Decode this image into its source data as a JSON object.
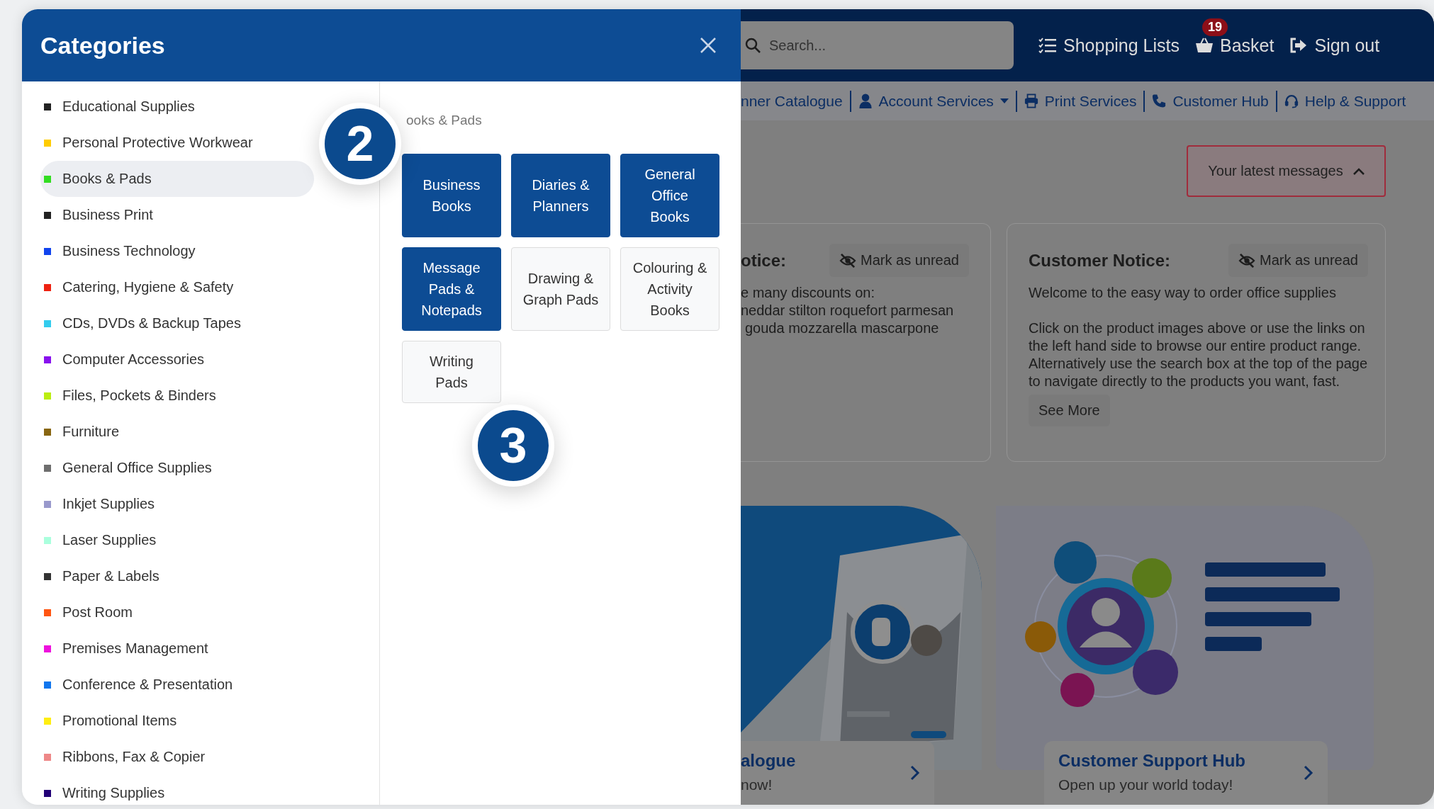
{
  "drawer": {
    "title": "Categories",
    "categories": [
      {
        "label": "Educational Supplies",
        "color": "#222222",
        "selected": false
      },
      {
        "label": "Personal Protective Workwear",
        "color": "#ffcc00",
        "selected": false
      },
      {
        "label": "Books & Pads",
        "color": "#33dd22",
        "selected": true
      },
      {
        "label": "Business Print",
        "color": "#222222",
        "selected": false
      },
      {
        "label": "Business Technology",
        "color": "#1144ee",
        "selected": false
      },
      {
        "label": "Catering, Hygiene & Safety",
        "color": "#ee2211",
        "selected": false
      },
      {
        "label": "CDs, DVDs & Backup Tapes",
        "color": "#33ccee",
        "selected": false
      },
      {
        "label": "Computer Accessories",
        "color": "#8811ee",
        "selected": false
      },
      {
        "label": "Files, Pockets & Binders",
        "color": "#bbee11",
        "selected": false
      },
      {
        "label": "Furniture",
        "color": "#886611",
        "selected": false
      },
      {
        "label": "General Office Supplies",
        "color": "#6e6e6e",
        "selected": false
      },
      {
        "label": "Inkjet Supplies",
        "color": "#9999cc",
        "selected": false
      },
      {
        "label": "Laser Supplies",
        "color": "#aaffdd",
        "selected": false
      },
      {
        "label": "Paper & Labels",
        "color": "#333333",
        "selected": false
      },
      {
        "label": "Post Room",
        "color": "#ff5511",
        "selected": false
      },
      {
        "label": "Premises Management",
        "color": "#ee11dd",
        "selected": false
      },
      {
        "label": "Conference & Presentation",
        "color": "#1177ee",
        "selected": false
      },
      {
        "label": "Promotional Items",
        "color": "#ffee11",
        "selected": false
      },
      {
        "label": "Ribbons, Fax & Copier",
        "color": "#ee8888",
        "selected": false
      },
      {
        "label": "Writing Supplies",
        "color": "#220077",
        "selected": false
      }
    ],
    "subcategory_heading": "ooks & Pads",
    "subcategories": [
      {
        "label": "Business Books",
        "highlighted": true
      },
      {
        "label": "Diaries & Planners",
        "highlighted": true
      },
      {
        "label": "General Office Books",
        "highlighted": true
      },
      {
        "label": "Message Pads & Notepads",
        "highlighted": true
      },
      {
        "label": "Drawing & Graph Pads",
        "highlighted": false
      },
      {
        "label": "Colouring & Activity Books",
        "highlighted": false
      },
      {
        "label": "Writing Pads",
        "highlighted": false
      }
    ],
    "step_markers": [
      "2",
      "3"
    ]
  },
  "page": {
    "search": {
      "placeholder": "Search..."
    },
    "header_links": [
      {
        "label": "Shopping Lists",
        "kind": "lists"
      },
      {
        "label": "Basket",
        "kind": "basket",
        "badge": "19"
      },
      {
        "label": "Sign out",
        "kind": "signout"
      }
    ],
    "nav": [
      {
        "label": "nner Catalogue",
        "kind": "plain",
        "dropdown": false
      },
      {
        "label": "Account Services",
        "kind": "account",
        "dropdown": true
      },
      {
        "label": "Print Services",
        "kind": "print",
        "dropdown": false
      },
      {
        "label": "Customer Hub",
        "kind": "phone",
        "dropdown": false
      },
      {
        "label": "Help & Support",
        "kind": "help",
        "dropdown": false
      }
    ],
    "messages_button": "Your latest messages",
    "notices": [
      {
        "title": "otice:",
        "mark_button": "Mark as unread",
        "lines": [
          "e many discounts on:",
          "neddar stilton roquefort parmesan",
          "gouda mozzarella mascarpone"
        ]
      },
      {
        "title": "Customer Notice:",
        "mark_button": "Mark as unread",
        "paragraphs": [
          "Welcome to the easy way to order office supplies",
          "Click on the product images above or use the links on the left hand side to browse our entire product range. Alternatively use the search box at the top of the page to navigate directly to the products you want, fast."
        ],
        "more_button": "See More"
      }
    ],
    "banners": [
      {
        "kind": "catalogue",
        "title": "alogue",
        "subtitle": "now!"
      },
      {
        "kind": "hub",
        "title": "Customer Support Hub",
        "subtitle": "Open up your world today!"
      }
    ]
  }
}
